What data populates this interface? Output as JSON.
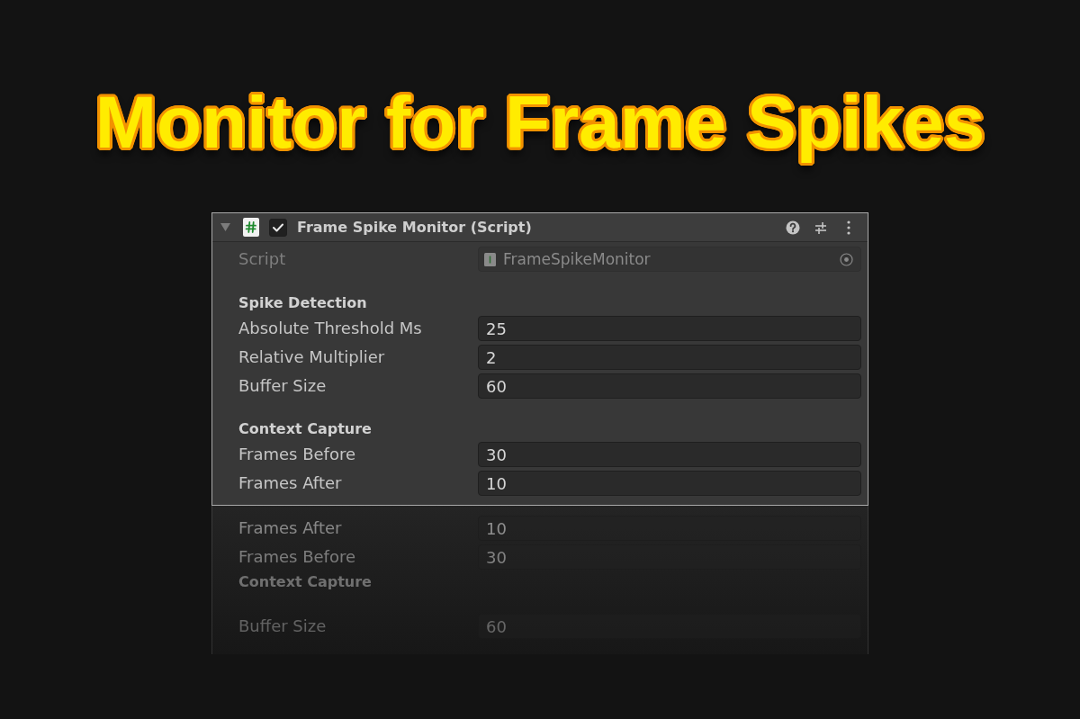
{
  "headline": {
    "text": "Monitor for Frame Spikes"
  },
  "inspector": {
    "title": "Frame Spike Monitor (Script)",
    "expanded": true,
    "enabled": true,
    "script": {
      "label": "Script",
      "value": "FrameSpikeMonitor",
      "disabled": true
    },
    "sections": [
      {
        "heading": "Spike Detection",
        "fields": [
          {
            "label": "Absolute Threshold Ms",
            "value": "25"
          },
          {
            "label": "Relative Multiplier",
            "value": "2"
          },
          {
            "label": "Buffer Size",
            "value": "60"
          }
        ]
      },
      {
        "heading": "Context Capture",
        "fields": [
          {
            "label": "Frames Before",
            "value": "30"
          },
          {
            "label": "Frames After",
            "value": "10"
          }
        ]
      }
    ]
  },
  "reflection": {
    "rows": [
      {
        "kind": "field",
        "label": "Frames After",
        "value": "10"
      },
      {
        "kind": "field",
        "label": "Frames Before",
        "value": "30"
      },
      {
        "kind": "heading",
        "label": "Context Capture"
      },
      {
        "kind": "field",
        "label": "Buffer Size",
        "value": "60"
      }
    ]
  }
}
